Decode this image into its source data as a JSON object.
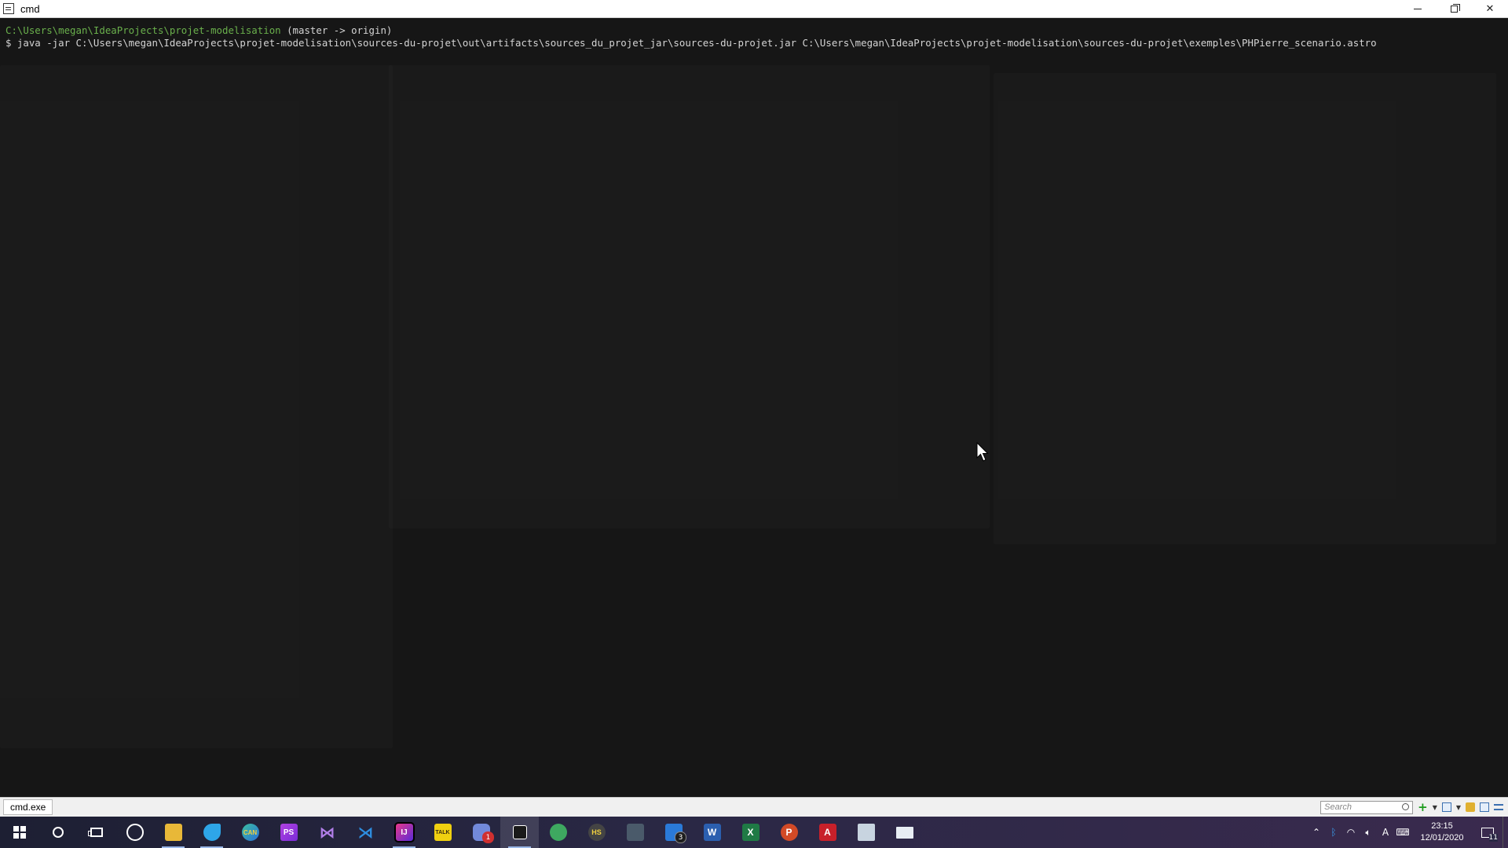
{
  "window": {
    "title": "cmd",
    "controls": {
      "minimize": "minimize-icon",
      "restore": "restore-icon",
      "close": "close-icon"
    }
  },
  "terminal": {
    "prompt_path": "C:\\Users\\megan\\IdeaProjects\\projet-modelisation",
    "prompt_branch": " (master -> origin)",
    "command_prefix": "$ ",
    "command": "java -jar C:\\Users\\megan\\IdeaProjects\\projet-modelisation\\sources-du-projet\\out\\artifacts\\sources_du_projet_jar\\sources-du-projet.jar C:\\Users\\megan\\IdeaProjects\\projet-modelisation\\sources-du-projet\\exemples\\PHPierre_scenario.astro",
    "colors": {
      "background": "#161616",
      "path": "#6ab04c",
      "text": "#d4d4d4"
    }
  },
  "statusbar": {
    "tab_label": "cmd.exe",
    "search_placeholder": "Search"
  },
  "taskbar": {
    "apps": [
      {
        "name": "start",
        "icon": "windows-logo-icon"
      },
      {
        "name": "search",
        "icon": "search-icon"
      },
      {
        "name": "task-view",
        "icon": "task-view-icon"
      },
      {
        "name": "app-1",
        "icon": "browser-swirl-icon"
      },
      {
        "name": "file-explorer",
        "icon": "folder-icon"
      },
      {
        "name": "app-bird",
        "icon": "bird-icon"
      },
      {
        "name": "edge-canary",
        "icon": "edge-canary-icon",
        "label": "CAN"
      },
      {
        "name": "phpstorm",
        "icon": "phpstorm-icon",
        "label": "PS"
      },
      {
        "name": "visual-studio",
        "icon": "visual-studio-icon"
      },
      {
        "name": "vscode",
        "icon": "vscode-icon"
      },
      {
        "name": "intellij",
        "icon": "intellij-icon",
        "label": "IJ"
      },
      {
        "name": "kakaotalk",
        "icon": "chat-talk-icon",
        "label": "TALK"
      },
      {
        "name": "discord",
        "icon": "discord-icon",
        "badge": "1"
      },
      {
        "name": "cmd",
        "icon": "terminal-icon"
      },
      {
        "name": "android-studio",
        "icon": "android-studio-icon"
      },
      {
        "name": "hs-app",
        "icon": "hs-icon",
        "label": "HS"
      },
      {
        "name": "app-network",
        "icon": "network-app-icon"
      },
      {
        "name": "app-files",
        "icon": "documents-icon",
        "badge": "3"
      },
      {
        "name": "word",
        "icon": "word-icon",
        "label": "W"
      },
      {
        "name": "excel",
        "icon": "excel-icon",
        "label": "X"
      },
      {
        "name": "powerpoint",
        "icon": "powerpoint-icon",
        "label": "P"
      },
      {
        "name": "acrobat",
        "icon": "acrobat-icon",
        "label": "A"
      },
      {
        "name": "app-window",
        "icon": "window-app-icon"
      },
      {
        "name": "app-monitor",
        "icon": "monitor-icon"
      }
    ],
    "tray": {
      "time": "23:15",
      "date": "12/01/2020",
      "notifications": "11",
      "input_indicator": "A"
    }
  }
}
